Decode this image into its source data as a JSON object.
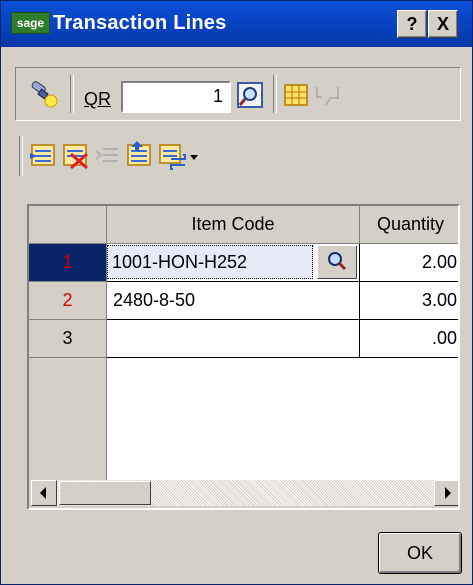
{
  "window": {
    "logo_text": "sage",
    "title": "Transaction Lines",
    "help_label": "?",
    "close_label": "X"
  },
  "toolbar": {
    "qr_label": "QR",
    "qr_value": "1"
  },
  "grid": {
    "columns": [
      "",
      "Item Code",
      "Quantity"
    ],
    "rows": [
      {
        "num": "1",
        "item_code": "1001-HON-H252",
        "quantity": "2.00"
      },
      {
        "num": "2",
        "item_code": "2480-8-50",
        "quantity": "3.00"
      },
      {
        "num": "3",
        "item_code": "",
        "quantity": ".00"
      }
    ]
  },
  "footer": {
    "ok_label": "OK"
  },
  "colors": {
    "titlebar": "#0a4fd8",
    "selected_row_header": "#0a246a",
    "row_number_red": "#d00000",
    "selected_cell": "#e8eaf8"
  },
  "icons": [
    "lookup-light-icon",
    "qr-lookup-icon",
    "grid-icon",
    "comment-icon",
    "insert-line-icon",
    "delete-line-icon",
    "indent-icon",
    "move-line-icon",
    "more-icon"
  ]
}
